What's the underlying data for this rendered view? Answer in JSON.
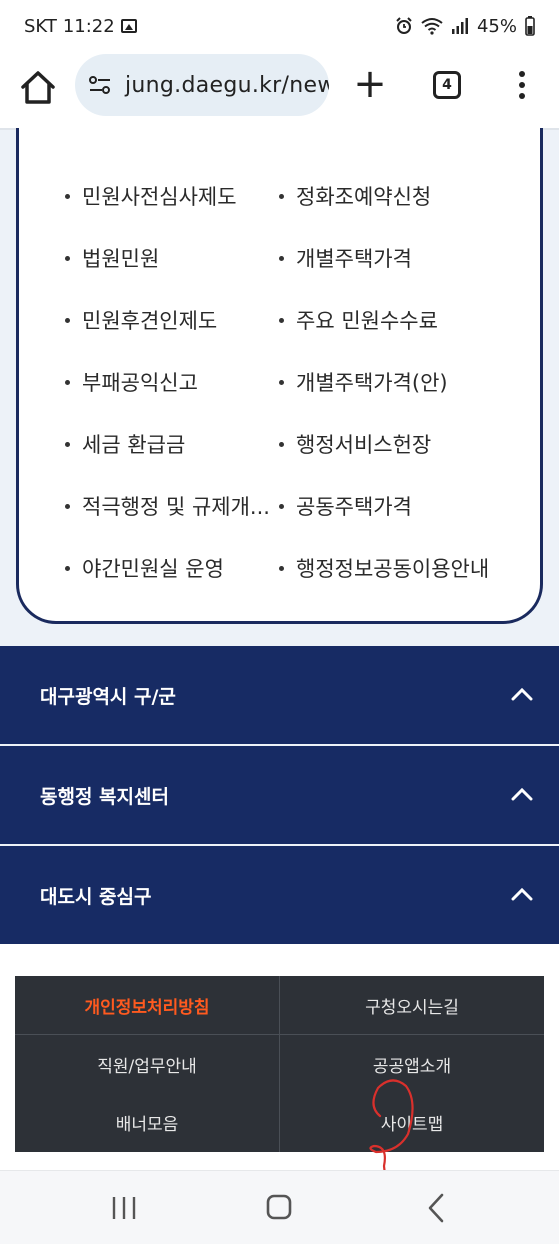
{
  "status_bar": {
    "carrier": "SKT",
    "time": "11:22",
    "battery": "45%"
  },
  "browser": {
    "url": "jung.daegu.kr/new",
    "tab_count": "4"
  },
  "menu_items": [
    {
      "left": "민원사전심사제도",
      "right": "정화조예약신청"
    },
    {
      "left": "법원민원",
      "right": "개별주택가격"
    },
    {
      "left": "민원후견인제도",
      "right": "주요 민원수수료"
    },
    {
      "left": "부패공익신고",
      "right": "개별주택가격(안)"
    },
    {
      "left": "세금 환급금",
      "right": "행정서비스헌장"
    },
    {
      "left": "적극행정 및 규제개...",
      "right": "공동주택가격"
    },
    {
      "left": "야간민원실 운영",
      "right": "행정정보공동이용안내"
    }
  ],
  "accordions": [
    {
      "label": "대구광역시 구/군"
    },
    {
      "label": "동행정 복지센터"
    },
    {
      "label": "대도시 중심구"
    }
  ],
  "footer_links": [
    {
      "label": "개인정보처리방침",
      "highlight": true
    },
    {
      "label": "구청오시는길"
    },
    {
      "label": "직원/업무안내"
    },
    {
      "label": "공공앱소개"
    },
    {
      "label": "배너모음"
    },
    {
      "label": "사이트맵"
    }
  ],
  "colors": {
    "accordion_bg": "#172b64",
    "footer_bg": "#2d3137",
    "highlight": "#ff5a1f",
    "url_bar_bg": "#e6eef5",
    "annotation": "#d9302c"
  }
}
